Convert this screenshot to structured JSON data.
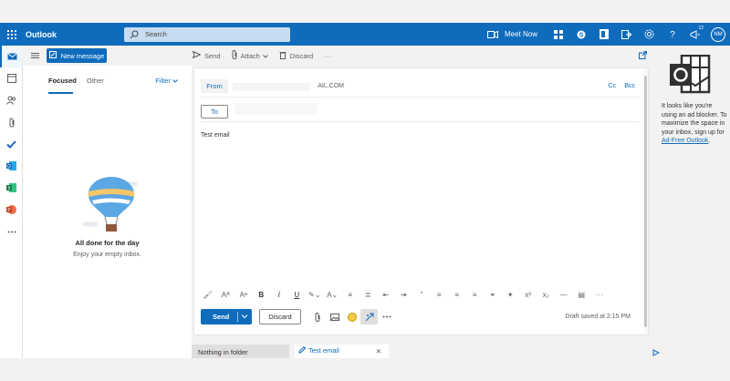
{
  "app": {
    "title": "Outlook",
    "accent": "#0f6cbd"
  },
  "topbar": {
    "search_placeholder": "Search",
    "meet_now": "Meet Now",
    "badge_count": "12",
    "avatar_initials": "NM",
    "icons": [
      "waffle-icon",
      "search-icon",
      "camera-icon",
      "grid-icon",
      "skype-icon",
      "office-icon",
      "forward-icon",
      "settings-icon",
      "help-icon",
      "megaphone-icon"
    ]
  },
  "rail": {
    "icons": [
      "mail-icon",
      "calendar-icon",
      "people-icon",
      "attach-icon",
      "todo-icon",
      "outlook-icon",
      "excel-icon",
      "powerpoint-icon",
      "more-icon"
    ]
  },
  "commandbar": {
    "new_message": "New message",
    "send": "Send",
    "attach": "Attach",
    "discard": "Discard",
    "more": "···"
  },
  "maillist": {
    "tabs": [
      {
        "label": "Focused",
        "active": true
      },
      {
        "label": "Other",
        "active": false
      }
    ],
    "filter": "Filter",
    "empty_title": "All done for the day",
    "empty_subtitle": "Enjoy your empty inbox."
  },
  "compose": {
    "from_label": "From",
    "from_value": "AIL.COM",
    "cc": "Cc",
    "bcc": "Bcc",
    "to_label": "To",
    "subject": "Test email",
    "format_buttons": [
      "🖌",
      "Aᴬ",
      "Aᵃ",
      "B",
      "I",
      "U",
      "✎⌄",
      "A⌄",
      "≡",
      "≣",
      "⇤",
      "⇥",
      "”",
      "≡",
      "≡",
      "≡",
      "⚭",
      "✦",
      "x²",
      "x₂",
      "—",
      "▤",
      "···"
    ],
    "send": "Send",
    "discard": "Discard",
    "draft_status": "Draft saved at 2:15 PM"
  },
  "bottom_tabs": {
    "folder": "Nothing in folder",
    "draft_tab": "Test email",
    "close": "✕"
  },
  "ad": {
    "text": "It looks like you're using an ad blocker. To maximize the space in your inbox, sign up for ",
    "link": "Ad-Free Outlook",
    "period": "."
  }
}
